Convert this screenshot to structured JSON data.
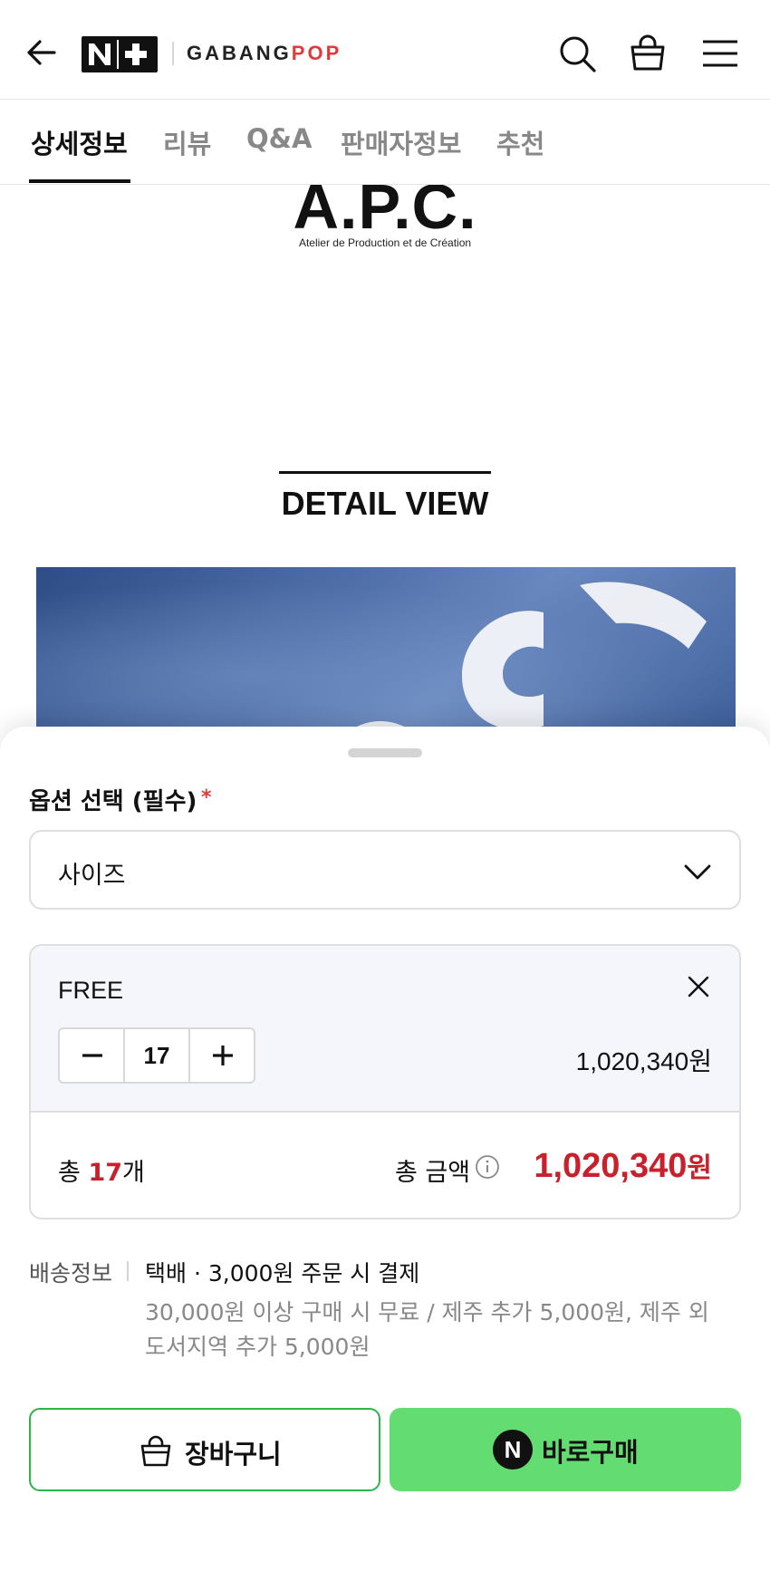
{
  "header": {
    "brand_badge": "N+",
    "store_name_main": "GABANG",
    "store_name_accent": "POP",
    "icons": [
      "back-arrow-icon",
      "search-icon",
      "shopping-bag-icon",
      "hamburger-menu-icon"
    ]
  },
  "tabs": [
    {
      "label": "상세정보",
      "active": true
    },
    {
      "label": "리뷰",
      "active": false
    },
    {
      "label": "Q&A",
      "active": false
    },
    {
      "label": "판매자정보",
      "active": false
    },
    {
      "label": "추천",
      "active": false
    }
  ],
  "content": {
    "brand_logo": "A.P.C.",
    "brand_subtitle": "Atelier de Production et de Création",
    "section_title": "DETAIL VIEW"
  },
  "sheet": {
    "option_label": "옵션 선택 (필수)",
    "required_mark": "*",
    "select_value": "사이즈",
    "selected_option": {
      "name": "FREE",
      "quantity": "17",
      "price": "1,020,340원"
    },
    "total": {
      "count_prefix": "총 ",
      "count_value": "17",
      "count_suffix": "개",
      "amount_label": "총 금액",
      "amount_value": "1,020,340",
      "amount_unit": "원"
    },
    "shipping": {
      "label": "배송정보",
      "main": "택배 · 3,000원 주문 시 결제",
      "note": "30,000원 이상 구매 시 무료 / 제주 추가 5,000원, 제주 외 도서지역 추가 5,000원"
    },
    "buttons": {
      "cart": "장바구니",
      "buy_badge": "N",
      "buy": "바로구매"
    }
  },
  "colors": {
    "accent_red": "#c8202c",
    "buy_green": "#63dd72",
    "cart_border_green": "#2db34a"
  }
}
